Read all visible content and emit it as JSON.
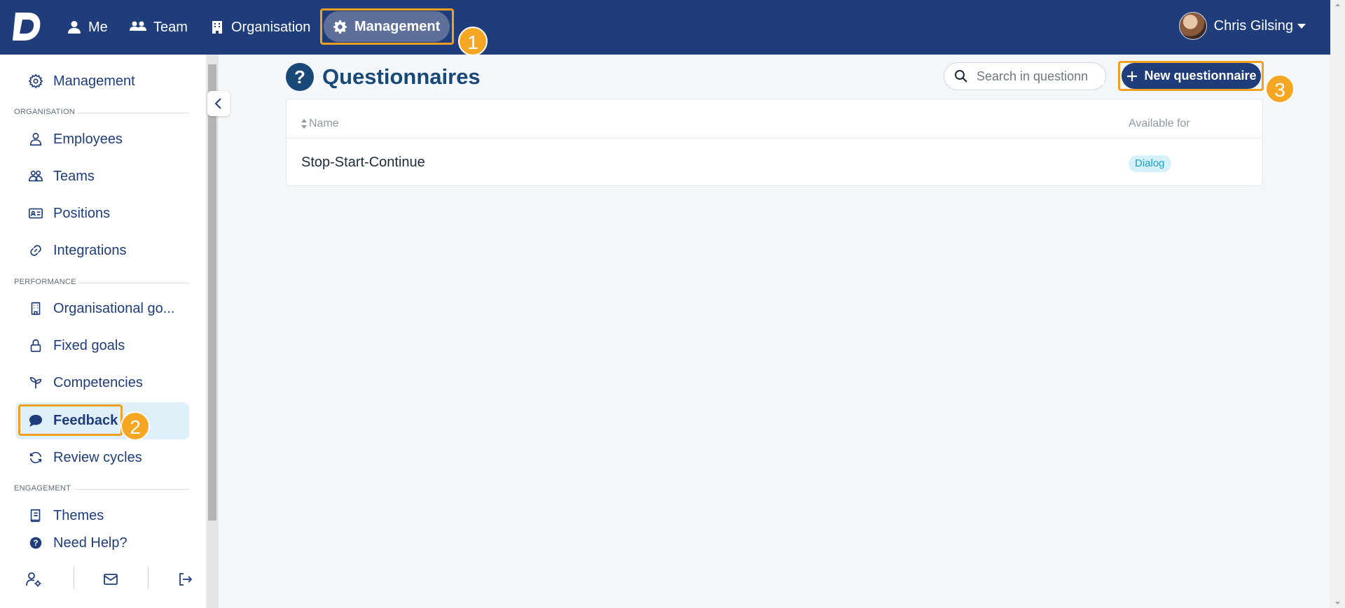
{
  "topnav": {
    "items": [
      {
        "label": "Me",
        "icon": "user-icon"
      },
      {
        "label": "Team",
        "icon": "users-icon"
      },
      {
        "label": "Organisation",
        "icon": "building-icon"
      }
    ],
    "active": {
      "label": "Management",
      "icon": "gear-icon"
    },
    "user_name": "Chris Gilsing"
  },
  "badges": {
    "one": "1",
    "two": "2",
    "three": "3"
  },
  "sidebar": {
    "management_label": "Management",
    "sections": {
      "organisation": "ORGANISATION",
      "performance": "PERFORMANCE",
      "engagement": "ENGAGEMENT"
    },
    "org_items": [
      "Employees",
      "Teams",
      "Positions",
      "Integrations"
    ],
    "perf_items": [
      "Organisational go...",
      "Fixed goals",
      "Competencies",
      "Feedback",
      "Review cycles"
    ],
    "eng_items": [
      "Themes"
    ],
    "help_label": "Need Help?"
  },
  "main": {
    "title": "Questionnaires",
    "title_icon": "?",
    "search_placeholder": "Search in questionn",
    "new_button": "New questionnaire",
    "columns": {
      "name": "Name",
      "available": "Available for"
    },
    "rows": [
      {
        "name": "Stop-Start-Continue",
        "available": "Dialog"
      }
    ]
  },
  "colors": {
    "brand": "#1f3d7a",
    "highlight": "#f0a020",
    "badge": "#f5a623"
  }
}
